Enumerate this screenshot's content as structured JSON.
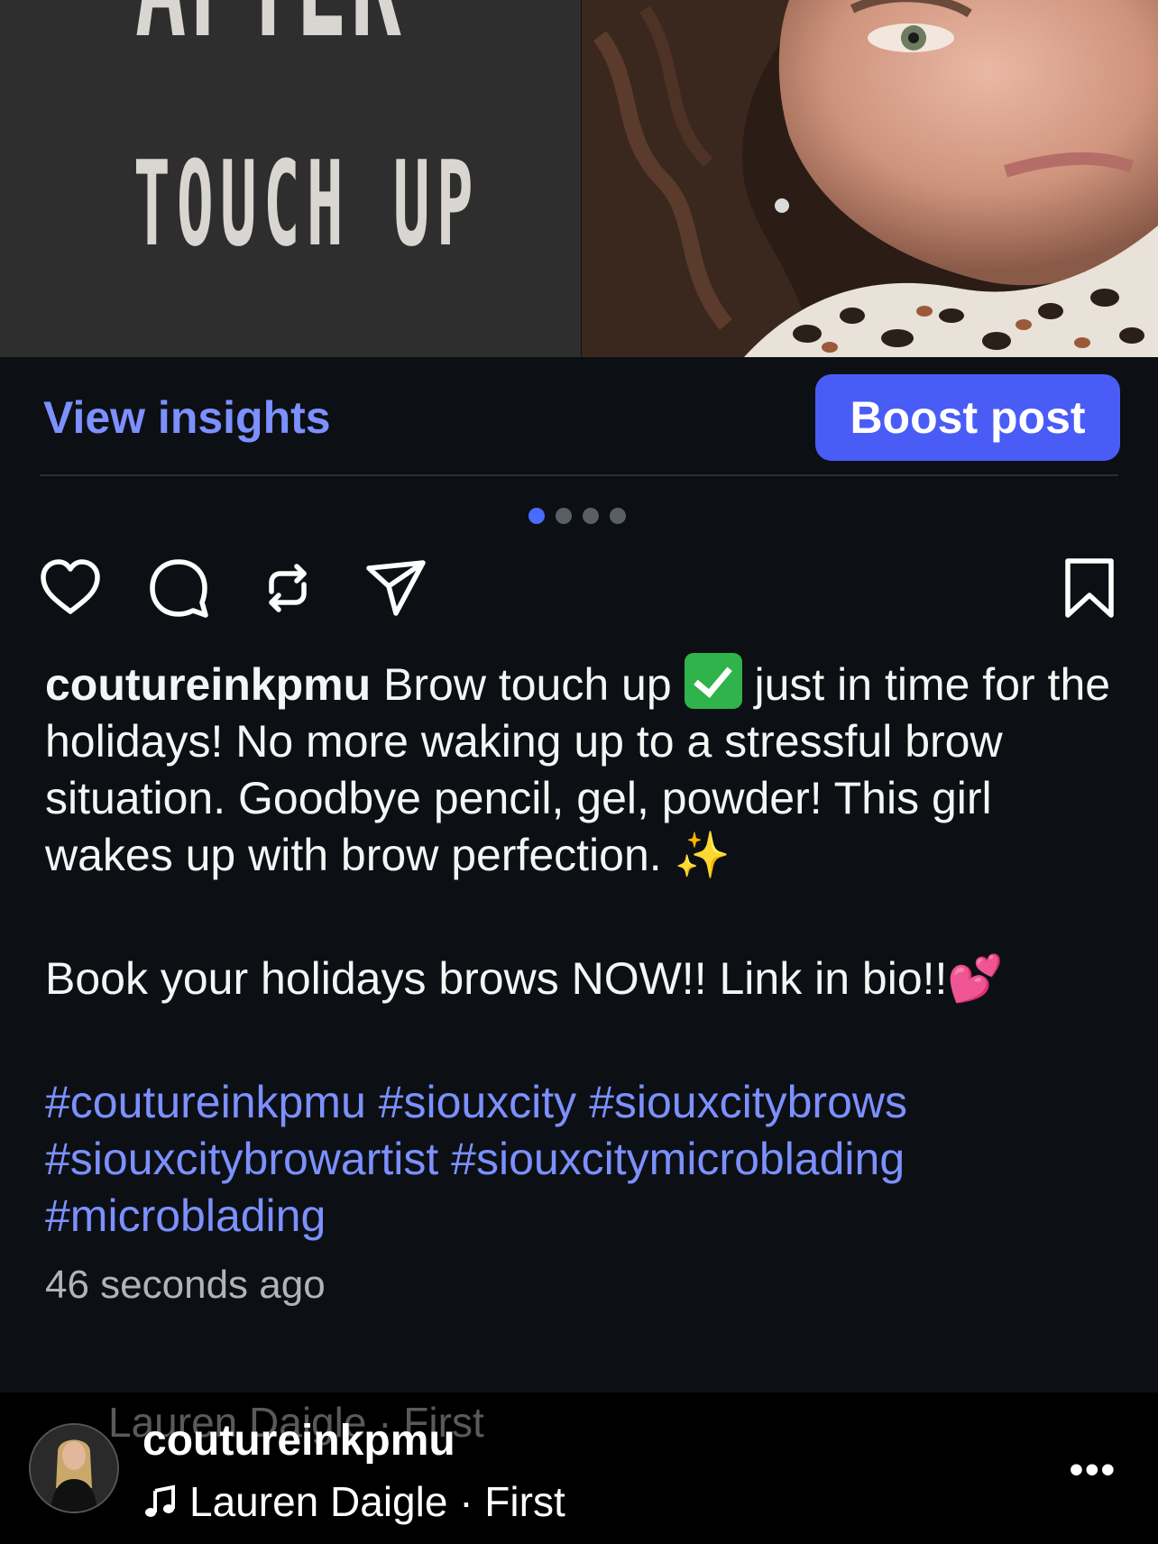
{
  "media": {
    "left_panel": {
      "line1": "AFTER",
      "line2": "TOUCH UP"
    },
    "carousel": {
      "count": 4,
      "active_index": 0
    }
  },
  "actions": {
    "view_insights": "View insights",
    "boost_post": "Boost post",
    "icons": [
      "heart-icon",
      "comment-icon",
      "repost-icon",
      "share-icon",
      "bookmark-icon"
    ]
  },
  "caption": {
    "username": "coutureinkpmu",
    "text1": " Brow touch up ",
    "text2": " just in time for the holidays! No more waking up to a stressful brow situation. Goodbye pencil, gel, powder! This girl wakes up with brow perfection. ",
    "sparkles": "✨",
    "book_line": "Book your holidays brows NOW!! Link in bio!!",
    "hearts": "💕",
    "hashtags": "#coutureinkpmu #siouxcity #siouxcitybrows #siouxcitybrowartist #siouxcitymicroblading #microblading"
  },
  "timestamp": "46 seconds ago",
  "audio_bar": {
    "ghost_text": "Lauren Daigle · First",
    "username": "coutureinkpmu",
    "track": "Lauren Daigle · First",
    "more": "•••"
  },
  "colors": {
    "background": "#0c1014",
    "accent_link": "#7c90ff",
    "boost_button": "#4a5cf6",
    "carousel_active_dot": "#4a6bff"
  }
}
